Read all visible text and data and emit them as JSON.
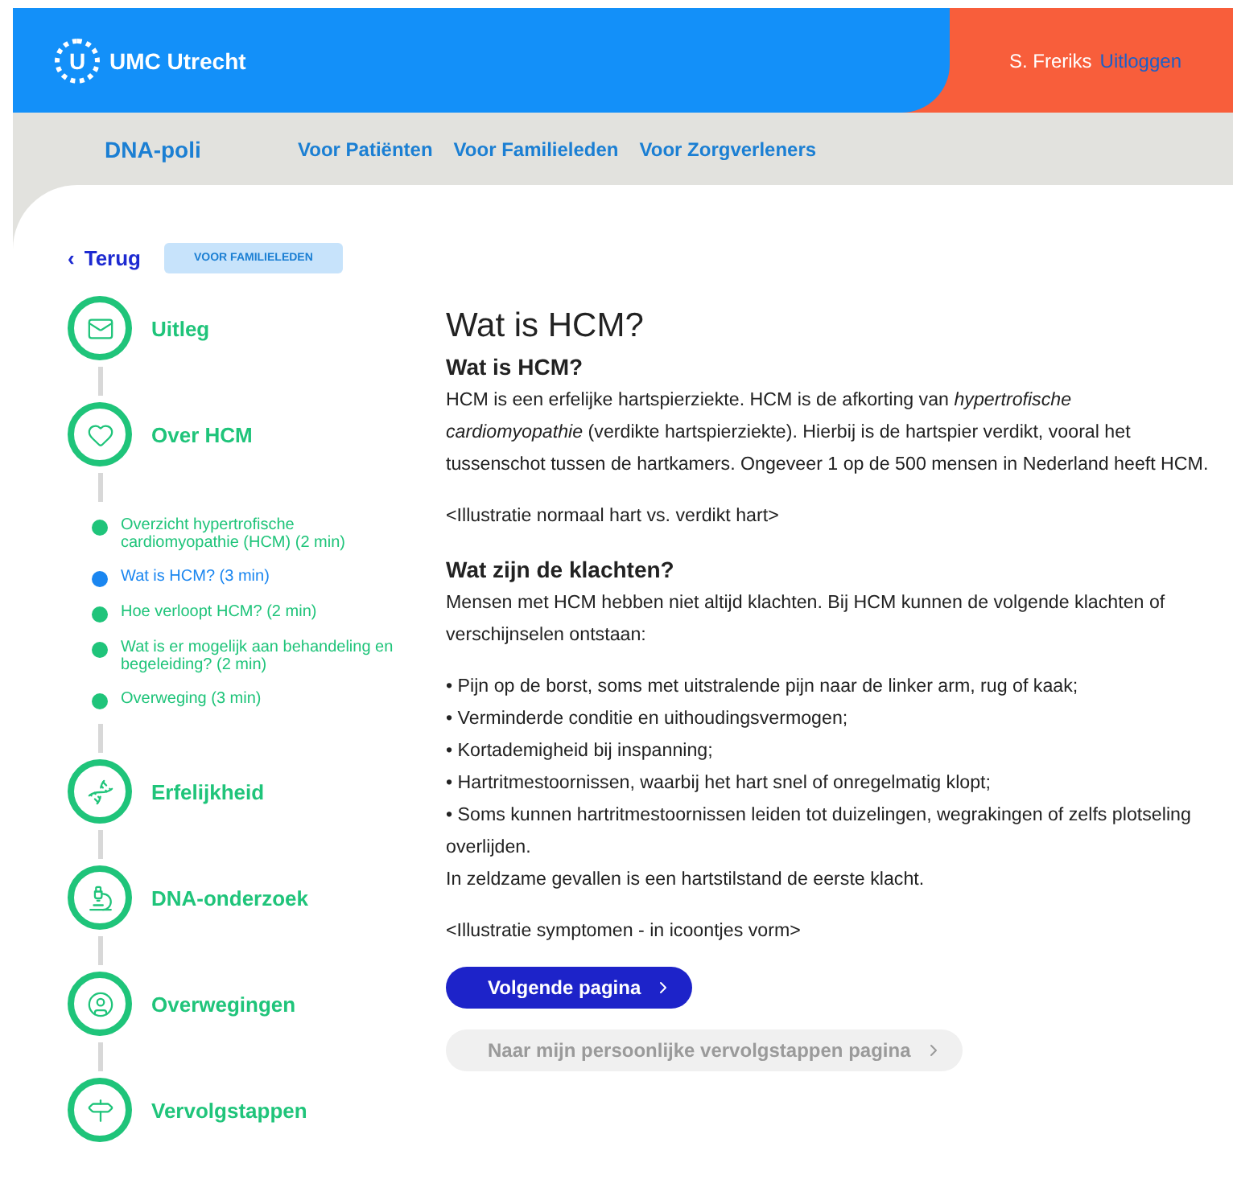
{
  "header": {
    "logo_letter": "U",
    "logo_text": "UMC Utrecht",
    "user_name": "S. Freriks",
    "logout": "Uitloggen"
  },
  "nav": {
    "brand": "DNA-poli",
    "links": [
      "Voor Patiënten",
      "Voor Familieleden",
      "Voor Zorgverleners"
    ]
  },
  "back": {
    "icon": "‹",
    "label": "Terug"
  },
  "audience_badge": "VOOR FAMILIELEDEN",
  "steps": [
    {
      "label": "Uitleg"
    },
    {
      "label": "Over HCM",
      "children": [
        {
          "label": "Overzicht hypertrofische cardiomyopathie (HCM) (2 min)",
          "selected": false
        },
        {
          "label": "Wat is HCM? (3 min)",
          "selected": true
        },
        {
          "label": "Hoe verloopt HCM? (2 min)",
          "selected": false
        },
        {
          "label": "Wat is er mogelijk aan behandeling en begeleiding? (2 min)",
          "selected": false
        },
        {
          "label": "Overweging (3 min)",
          "selected": false
        }
      ]
    },
    {
      "label": "Erfelijkheid"
    },
    {
      "label": "DNA-onderzoek"
    },
    {
      "label": "Overwegingen"
    },
    {
      "label": "Vervolgstappen"
    }
  ],
  "article": {
    "title": "Wat is HCM?",
    "blocks": [
      {
        "kind": "heading",
        "text": "Wat is HCM?"
      },
      {
        "kind": "paragraph",
        "text": "HCM is een erfelijke hartspierziekte. HCM is de afkorting van *hypertrofische cardiomyopathie* (verdikte hartspierziekte). Hierbij is de hartspier verdikt, vooral het tussenschot tussen de hartkamers. Ongeveer 1 op de 500 mensen in Nederland heeft HCM."
      },
      {
        "kind": "paragraph",
        "text": "<Illustratie normaal hart vs. verdikt hart>"
      },
      {
        "kind": "heading",
        "text": "Wat zijn de klachten?"
      },
      {
        "kind": "paragraph",
        "text": "Mensen met HCM hebben niet altijd klachten. Bij HCM kunnen de volgende klachten of verschijnselen ontstaan:"
      },
      {
        "kind": "list",
        "items": [
          "• Pijn op de borst, soms met uitstralende pijn naar de linker arm, rug of kaak;",
          "• Verminderde conditie en uithoudingsvermogen;",
          "• Kortademigheid bij inspanning;",
          "• Hartritmestoornissen, waarbij het hart snel of onregelmatig klopt;",
          "• Soms kunnen hartritmestoornissen leiden tot duizelingen, wegrakingen of zelfs plotseling overlijden.",
          "In zeldzame gevallen is een hartstilstand de eerste klacht."
        ]
      },
      {
        "kind": "paragraph",
        "text": "<Illustratie symptomen - in icoontjes vorm>"
      }
    ]
  },
  "buttons": [
    {
      "label": "Volgende pagina",
      "disabled": false
    },
    {
      "label": "Naar mijn persoonlijke vervolgstappen pagina",
      "disabled": true
    }
  ]
}
